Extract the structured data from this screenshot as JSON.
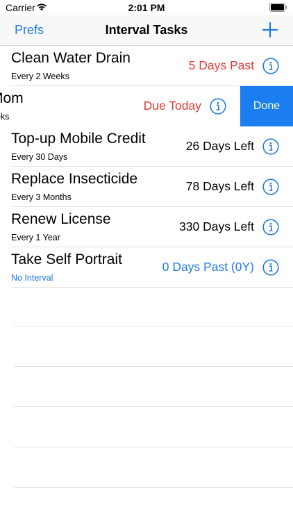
{
  "status_bar": {
    "carrier": "Carrier",
    "time": "2:01 PM"
  },
  "nav": {
    "left_button": "Prefs",
    "title": "Interval Tasks",
    "add_icon": "plus-icon"
  },
  "tasks": [
    {
      "title": "Clean Water Drain",
      "interval": "Every 2 Weeks",
      "status": "5 Days Past"
    },
    {
      "title": "Mom",
      "interval": "eeks",
      "status": "Due Today",
      "action": "Done"
    },
    {
      "title": "Top-up Mobile Credit",
      "interval": "Every 30 Days",
      "status": "26 Days Left"
    },
    {
      "title": "Replace Insecticide",
      "interval": "Every 3 Months",
      "status": "78 Days Left"
    },
    {
      "title": "Renew License",
      "interval": "Every 1 Year",
      "status": "330 Days Left"
    },
    {
      "title": "Take Self Portrait",
      "interval": "No Interval",
      "status": "0 Days Past (0Y)"
    }
  ],
  "colors": {
    "accent": "#1f7ae0",
    "overdue": "#e33b34",
    "done_action": "#1a7ef0"
  }
}
